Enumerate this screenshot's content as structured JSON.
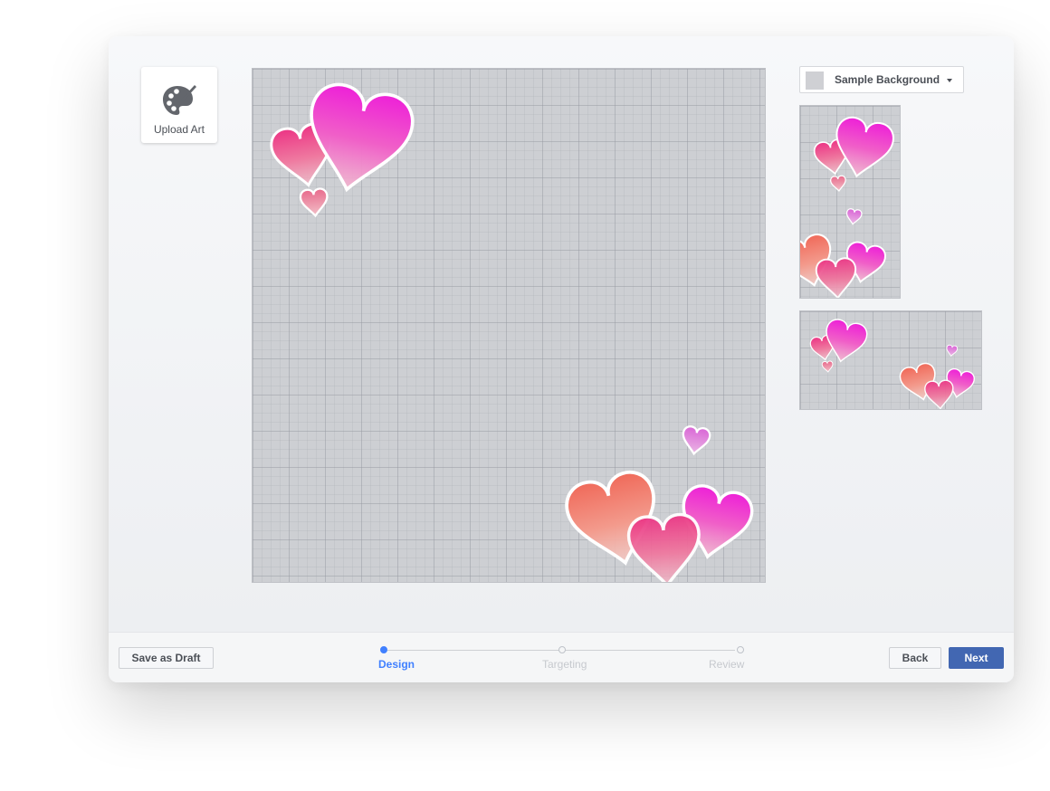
{
  "toolbar": {
    "upload_label": "Upload Art",
    "upload_icon": "palette-icon"
  },
  "background_select": {
    "selected": "Sample Background",
    "swatch_color": "#cfd0d4"
  },
  "footer": {
    "save_draft_label": "Save as Draft",
    "back_label": "Back",
    "next_label": "Next",
    "steps": [
      {
        "label": "Design",
        "state": "active"
      },
      {
        "label": "Targeting",
        "state": "inactive"
      },
      {
        "label": "Review",
        "state": "inactive"
      }
    ]
  },
  "colors": {
    "primary": "#4267b2",
    "step_active": "#4080ff",
    "heart_magenta": "#ee22d0",
    "heart_coral": "#f07a6a"
  }
}
